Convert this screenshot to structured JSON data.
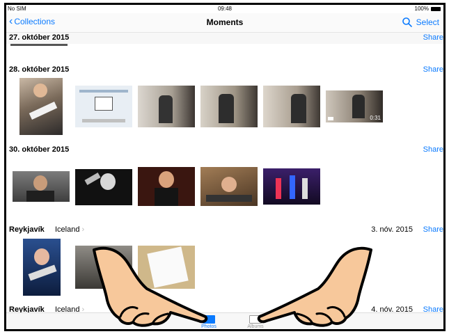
{
  "status_bar": {
    "carrier": "No SIM",
    "time": "09:48",
    "battery": "100%"
  },
  "nav": {
    "back_label": "Collections",
    "title": "Moments",
    "select_label": "Select"
  },
  "sections": [
    {
      "title": "27. október 2015",
      "share": "Share"
    },
    {
      "title": "28. október 2015",
      "share": "Share",
      "video_duration": "0:31"
    },
    {
      "title": "30. október 2015",
      "share": "Share"
    },
    {
      "location": "Reykjavík",
      "sublocation": "Iceland",
      "date": "3. nóv. 2015",
      "share": "Share"
    },
    {
      "location": "Reykjavík",
      "sublocation": "Iceland",
      "date": "4. nóv. 2015",
      "share": "Share"
    }
  ],
  "tabs": [
    {
      "label": "Photos",
      "active": true
    },
    {
      "label": "Albums",
      "active": false
    }
  ],
  "colors": {
    "accent": "#0a7aff",
    "skin": "#f7c89b"
  }
}
